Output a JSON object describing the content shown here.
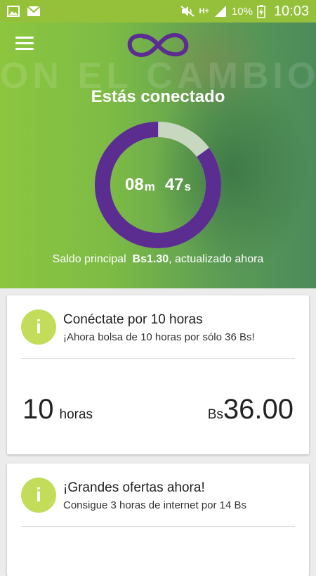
{
  "status_bar": {
    "network_type": "H+",
    "battery": "10%",
    "time": "10:03"
  },
  "hero": {
    "background_text": "ON EL CAMBIO",
    "title": "Estás conectado",
    "timer": {
      "minutes": "08",
      "minutes_unit": "m",
      "seconds": "47",
      "seconds_unit": "s",
      "remaining_fraction": 0.85
    },
    "balance": {
      "label": "Saldo principal",
      "amount": "Bs1.30",
      "suffix": ", actualizado ahora"
    }
  },
  "offers": [
    {
      "icon_label": "i",
      "title": "Conéctate por 10 horas",
      "subtitle": "¡Ahora bolsa de 10 horas por sólo 36 Bs!",
      "quantity": "10",
      "quantity_unit": "horas",
      "currency": "Bs",
      "price": "36.00"
    },
    {
      "icon_label": "i",
      "title": "¡Grandes ofertas ahora!",
      "subtitle": "Consigue 3 horas de internet por 14 Bs"
    }
  ],
  "colors": {
    "status_bar": "#95c13a",
    "ring_progress": "#5b2d91",
    "ring_track": "#c8d8c0",
    "info_icon": "#c3dd5b",
    "logo": "#5b2d91"
  }
}
